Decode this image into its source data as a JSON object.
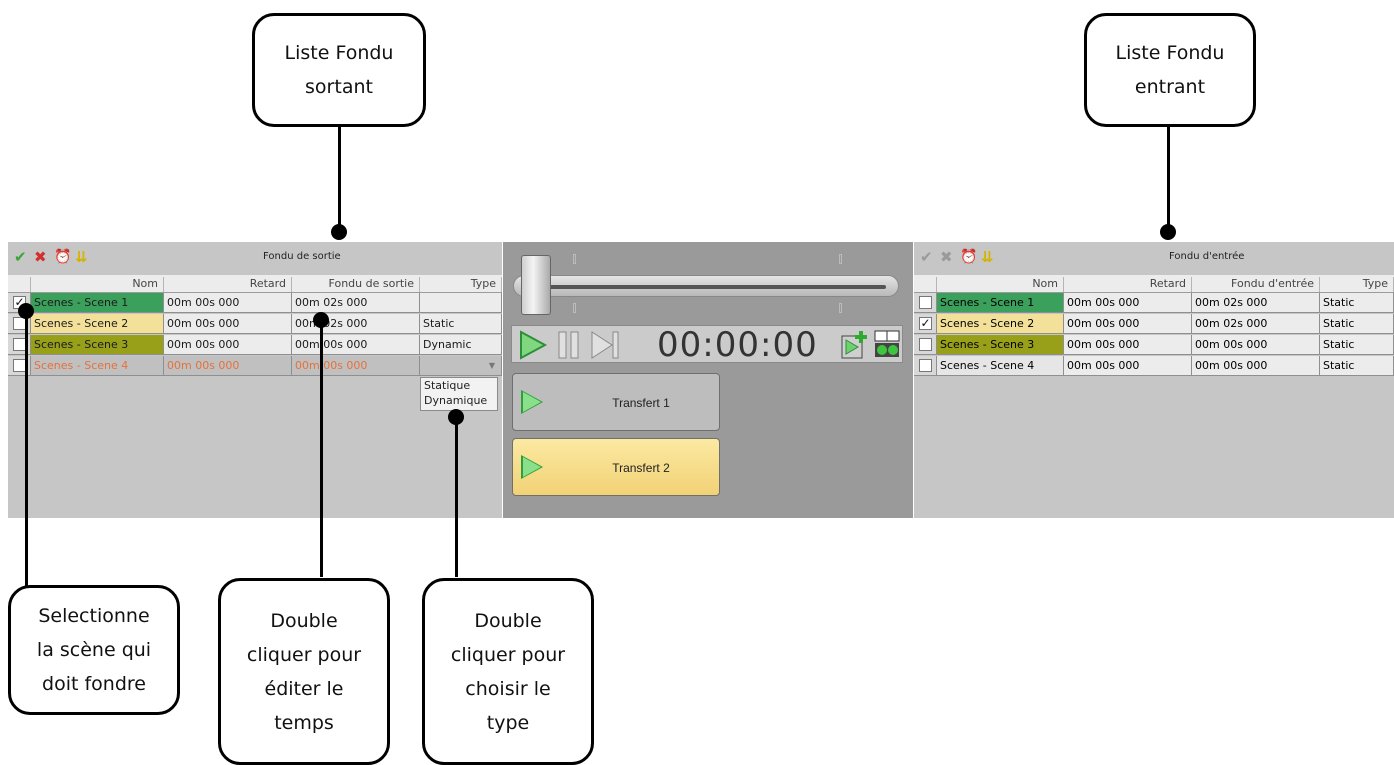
{
  "callouts": {
    "out_list": "Liste Fondu\nsortant",
    "in_list": "Liste Fondu\nentrant",
    "select_scene": "Selectionne\nla scène qui\ndoit fondre",
    "edit_time": "Double\ncliquer pour\néditer le\ntemps",
    "choose_type": "Double\ncliquer pour\nchoisir le\ntype"
  },
  "left_panel": {
    "title": "Fondu de sortie",
    "columns": [
      "Nom",
      "Retard",
      "Fondu de sortie",
      "Type"
    ],
    "rows": [
      {
        "checked": true,
        "name": "Scenes - Scene 1",
        "delay": "00m 00s 000",
        "fade": "00m 02s 000",
        "type": "",
        "color": "#3aa05c",
        "text_color": "#1a1a1a"
      },
      {
        "checked": false,
        "name": "Scenes - Scene 2",
        "delay": "00m 00s 000",
        "fade": "00m 02s 000",
        "type": "Static",
        "color": "#f3e19a",
        "text_color": "#1a1a1a"
      },
      {
        "checked": false,
        "name": "Scenes - Scene 3",
        "delay": "00m 00s 000",
        "fade": "00m 00s 000",
        "type": "Dynamic",
        "color": "#98a01a",
        "text_color": "#1a1a1a"
      },
      {
        "checked": false,
        "name": "Scenes - Scene 4",
        "delay": "00m 00s 000",
        "fade": "00m 00s 000",
        "type": "",
        "color": "#c0c0c0",
        "text_color": "#e8703a"
      }
    ],
    "type_options": [
      "Statique",
      "Dynamique"
    ]
  },
  "right_panel": {
    "title": "Fondu d'entrée",
    "columns": [
      "Nom",
      "Retard",
      "Fondu d'entrée",
      "Type"
    ],
    "rows": [
      {
        "checked": false,
        "name": "Scenes - Scene 1",
        "delay": "00m 00s 000",
        "fade": "00m 02s 000",
        "type": "Static",
        "color": "#3aa05c"
      },
      {
        "checked": true,
        "name": "Scenes - Scene 2",
        "delay": "00m 00s 000",
        "fade": "00m 02s 000",
        "type": "Static",
        "color": "#f3e19a"
      },
      {
        "checked": false,
        "name": "Scenes - Scene 3",
        "delay": "00m 00s 000",
        "fade": "00m 00s 000",
        "type": "Static",
        "color": "#98a01a"
      },
      {
        "checked": false,
        "name": "Scenes - Scene 4",
        "delay": "00m 00s 000",
        "fade": "00m 00s 000",
        "type": "Static",
        "color": "#e6e6e6"
      }
    ]
  },
  "center": {
    "timer": "00:00:00",
    "transfers": [
      {
        "label": "Transfert 1",
        "active": false
      },
      {
        "label": "Transfert 2",
        "active": true
      }
    ]
  },
  "icons": {
    "toolbar": [
      "check-all-icon",
      "uncheck-all-icon",
      "clock-icon",
      "down-arrows-icon"
    ],
    "transport": [
      "play-icon",
      "pause-icon",
      "next-icon",
      "add-transfer-icon",
      "transfer-settings-icon"
    ]
  }
}
